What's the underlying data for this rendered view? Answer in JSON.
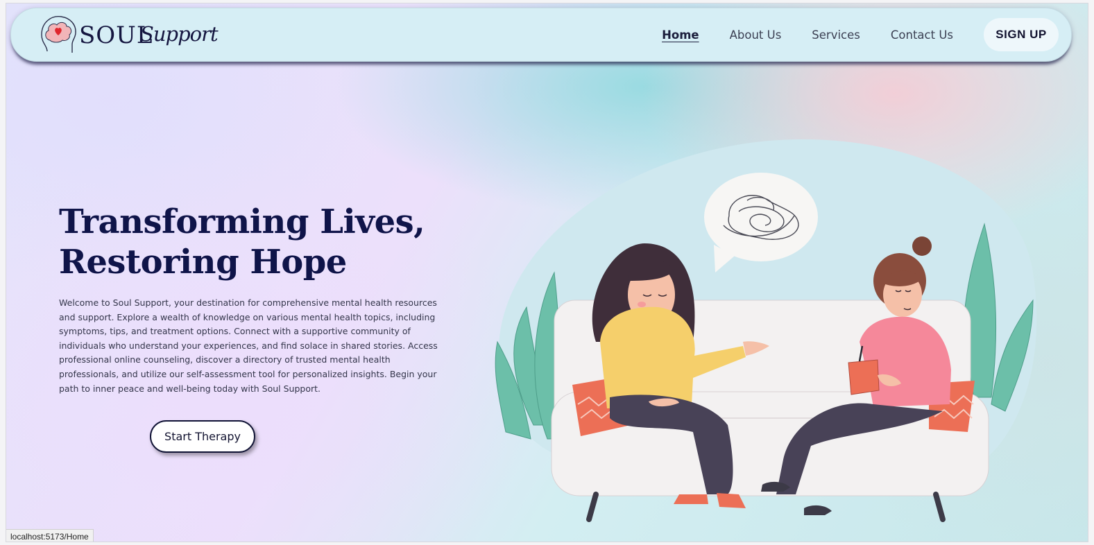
{
  "brand": {
    "word": "SOUL",
    "script": "Support"
  },
  "nav": {
    "items": [
      {
        "label": "Home",
        "active": true
      },
      {
        "label": "About Us",
        "active": false
      },
      {
        "label": "Services",
        "active": false
      },
      {
        "label": "Contact Us",
        "active": false
      }
    ],
    "signup_label": "SIGN UP"
  },
  "hero": {
    "title_line1": "Transforming Lives,",
    "title_line2": "Restoring Hope",
    "description": "Welcome to Soul Support, your destination for comprehensive mental health resources and support. Explore a wealth of knowledge on various mental health topics, including symptoms, tips, and treatment options. Connect with a supportive community of individuals who understand your experiences, and find solace in shared stories. Access professional online counseling, discover a directory of trusted mental health professionals, and utilize our self-assessment tool for personalized insights. Begin your path to inner peace and well-being today with Soul Support.",
    "cta_label": "Start Therapy"
  },
  "status_url": "localhost:5173/Home",
  "colors": {
    "navy": "#0f1449",
    "nav_bg": "#d6eef5",
    "sofa": "#f3f1f1",
    "cushion": "#ec6f56",
    "plant": "#6cbfa9",
    "sweater_left": "#f5cf6b",
    "sweater_right": "#f5889a",
    "pants": "#484257"
  }
}
